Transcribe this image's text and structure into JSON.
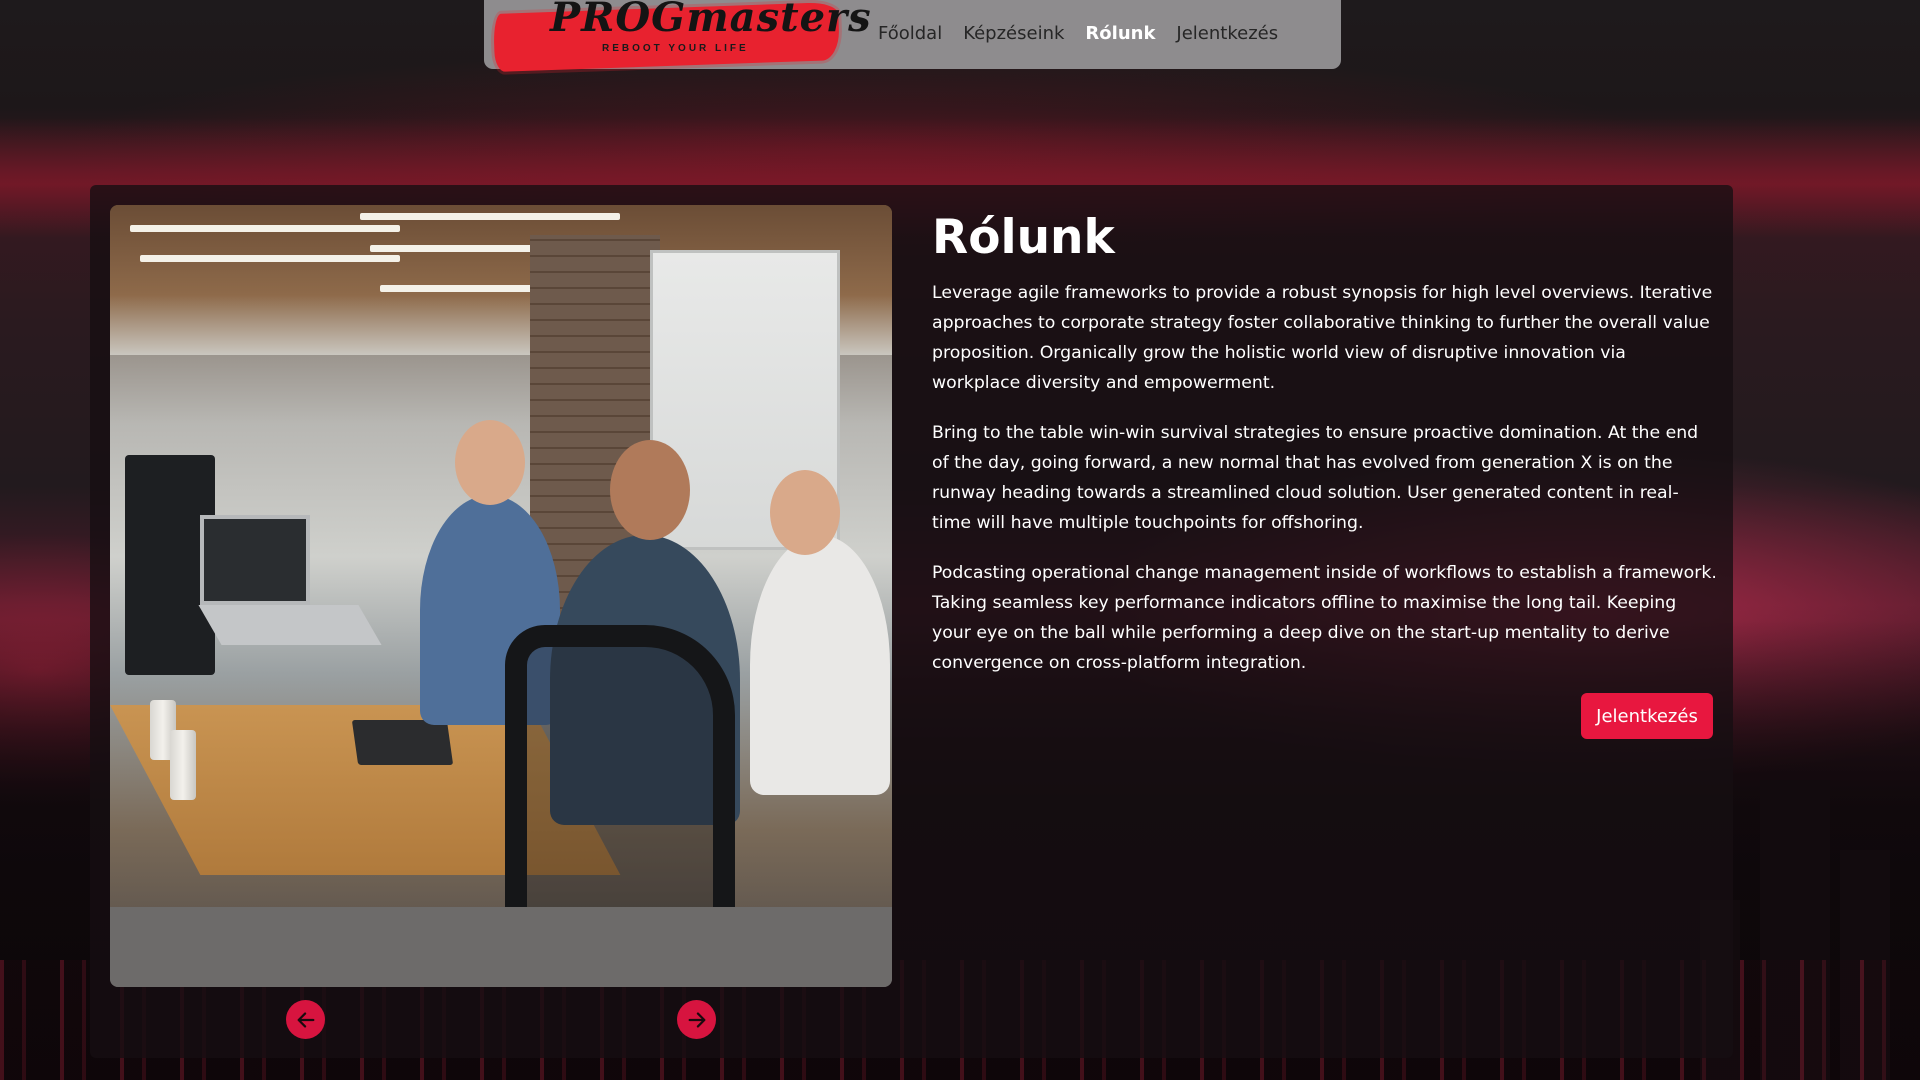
{
  "brand": {
    "name": "PROGmasters",
    "tagline": "REBOOT YOUR LIFE"
  },
  "nav": {
    "items": [
      {
        "label": "Főoldal",
        "active": false
      },
      {
        "label": "Képzéseink",
        "active": false
      },
      {
        "label": "Rólunk",
        "active": true
      },
      {
        "label": "Jelentkezés",
        "active": false
      }
    ]
  },
  "about": {
    "title": "Rólunk",
    "paragraphs": [
      "Leverage agile frameworks to provide a robust synopsis for high level overviews. Iterative approaches to corporate strategy foster collaborative thinking to further the overall value proposition. Organically grow the holistic world view of disruptive innovation via workplace diversity and empowerment.",
      "Bring to the table win-win survival strategies to ensure proactive domination. At the end of the day, going forward, a new normal that has evolved from generation X is on the runway heading towards a streamlined cloud solution. User generated content in real-time will have multiple touchpoints for offshoring.",
      "Podcasting operational change management inside of workflows to establish a framework. Taking seamless key performance indicators offline to maximise the long tail. Keeping your eye on the ball while performing a deep dive on the start-up mentality to derive convergence on cross-platform integration."
    ],
    "cta_label": "Jelentkezés"
  },
  "carousel": {
    "prev_icon": "arrow-left-icon",
    "next_icon": "arrow-right-icon"
  },
  "colors": {
    "accent": "#e8173f",
    "navbar_bg": "#8e8c8e",
    "panel_bg": "#160e12"
  }
}
